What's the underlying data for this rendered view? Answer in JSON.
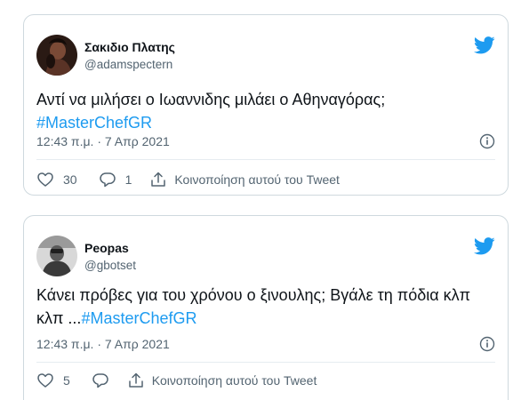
{
  "tweets": [
    {
      "display_name": "Σακιδιο Πλατης",
      "handle": "@adamspectern",
      "text": "Αντί να μιλήσει ο Ιωαννιδης μιλάει ο Αθηναγόρας;",
      "hashtag": "#MasterChefGR",
      "timestamp": "12:43 π.μ. · 7 Απρ 2021",
      "like_count": "30",
      "reply_count": "1",
      "share_label": "Κοινοποίηση αυτού του Tweet"
    },
    {
      "display_name": "Peopas",
      "handle": "@gbotset",
      "text": "Κάνει πρόβες για του χρόνου ο ξινουλης; Βγάλε τη πόδια κλπ κλπ ...",
      "hashtag": "#MasterChefGR",
      "timestamp": "12:43 π.μ. · 7 Απρ 2021",
      "like_count": "5",
      "reply_count": "",
      "share_label": "Κοινοποίηση αυτού του Tweet"
    }
  ],
  "icons": {
    "like": "heart-icon",
    "reply": "reply-icon",
    "share": "share-icon",
    "info": "info-icon",
    "brand": "twitter-bird-icon"
  },
  "colors": {
    "brand": "#1d9bf0",
    "text": "#0f1419",
    "secondary": "#536471",
    "border": "#cfd9de"
  }
}
